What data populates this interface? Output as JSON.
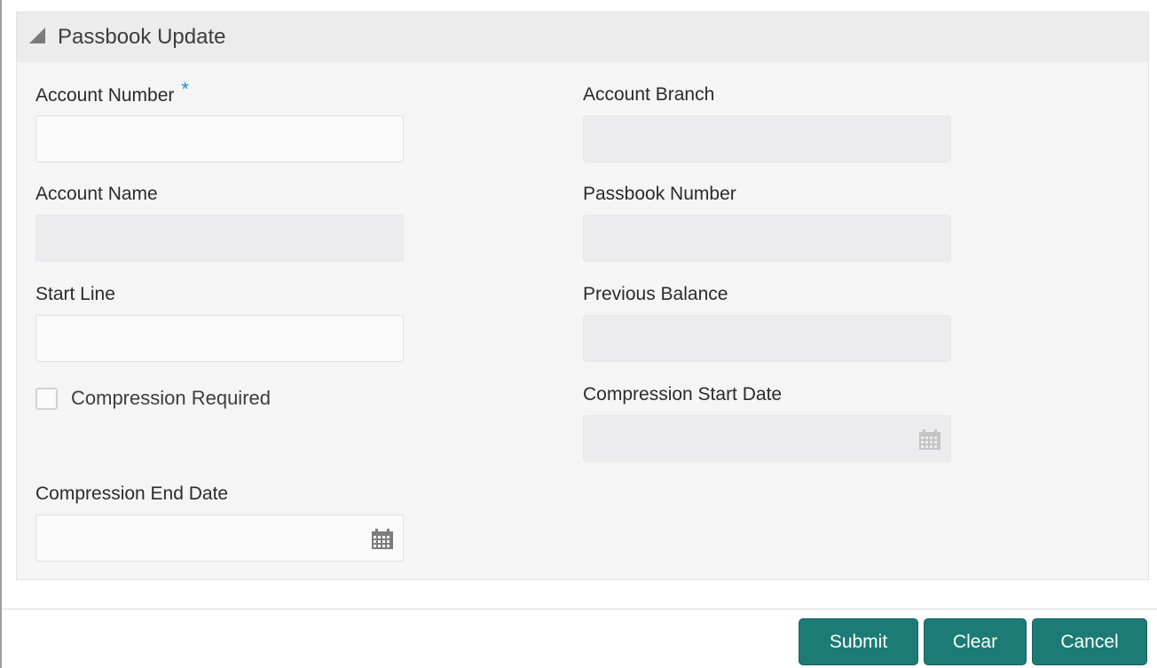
{
  "panel": {
    "title": "Passbook Update",
    "collapse_icon": "triangle-collapse-icon"
  },
  "fields": {
    "account_number": {
      "label": "Account Number",
      "required_mark": "*",
      "value": "",
      "readonly": false
    },
    "account_branch": {
      "label": "Account Branch",
      "value": "",
      "readonly": true
    },
    "account_name": {
      "label": "Account Name",
      "value": "",
      "readonly": true
    },
    "passbook_number": {
      "label": "Passbook Number",
      "value": "",
      "readonly": true
    },
    "start_line": {
      "label": "Start Line",
      "value": "",
      "readonly": false
    },
    "previous_balance": {
      "label": "Previous Balance",
      "value": "",
      "readonly": true
    },
    "compression_required": {
      "label": "Compression Required",
      "checked": false
    },
    "compression_start_date": {
      "label": "Compression Start Date",
      "value": "",
      "readonly": true,
      "icon": "calendar-icon"
    },
    "compression_end_date": {
      "label": "Compression End Date",
      "value": "",
      "readonly": false,
      "icon": "calendar-icon"
    }
  },
  "buttons": {
    "submit": "Submit",
    "clear": "Clear",
    "cancel": "Cancel"
  },
  "colors": {
    "primary_button": "#1d7b76",
    "required_asterisk": "#2a8fc4"
  }
}
